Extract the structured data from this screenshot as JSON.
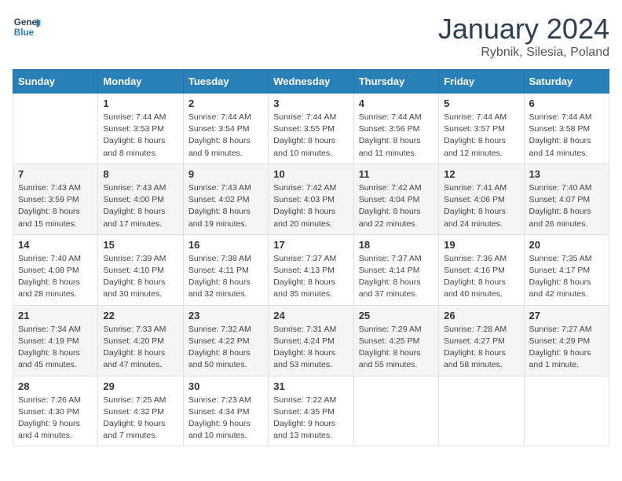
{
  "logo": {
    "line1": "General",
    "line2": "Blue"
  },
  "title": "January 2024",
  "location": "Rybnik, Silesia, Poland",
  "days": [
    "Sunday",
    "Monday",
    "Tuesday",
    "Wednesday",
    "Thursday",
    "Friday",
    "Saturday"
  ],
  "weeks": [
    [
      {
        "date": "",
        "content": ""
      },
      {
        "date": "1",
        "content": "Sunrise: 7:44 AM\nSunset: 3:53 PM\nDaylight: 8 hours\nand 8 minutes."
      },
      {
        "date": "2",
        "content": "Sunrise: 7:44 AM\nSunset: 3:54 PM\nDaylight: 8 hours\nand 9 minutes."
      },
      {
        "date": "3",
        "content": "Sunrise: 7:44 AM\nSunset: 3:55 PM\nDaylight: 8 hours\nand 10 minutes."
      },
      {
        "date": "4",
        "content": "Sunrise: 7:44 AM\nSunset: 3:56 PM\nDaylight: 8 hours\nand 11 minutes."
      },
      {
        "date": "5",
        "content": "Sunrise: 7:44 AM\nSunset: 3:57 PM\nDaylight: 8 hours\nand 12 minutes."
      },
      {
        "date": "6",
        "content": "Sunrise: 7:44 AM\nSunset: 3:58 PM\nDaylight: 8 hours\nand 14 minutes."
      }
    ],
    [
      {
        "date": "7",
        "content": "Sunrise: 7:43 AM\nSunset: 3:59 PM\nDaylight: 8 hours\nand 15 minutes."
      },
      {
        "date": "8",
        "content": "Sunrise: 7:43 AM\nSunset: 4:00 PM\nDaylight: 8 hours\nand 17 minutes."
      },
      {
        "date": "9",
        "content": "Sunrise: 7:43 AM\nSunset: 4:02 PM\nDaylight: 8 hours\nand 19 minutes."
      },
      {
        "date": "10",
        "content": "Sunrise: 7:42 AM\nSunset: 4:03 PM\nDaylight: 8 hours\nand 20 minutes."
      },
      {
        "date": "11",
        "content": "Sunrise: 7:42 AM\nSunset: 4:04 PM\nDaylight: 8 hours\nand 22 minutes."
      },
      {
        "date": "12",
        "content": "Sunrise: 7:41 AM\nSunset: 4:06 PM\nDaylight: 8 hours\nand 24 minutes."
      },
      {
        "date": "13",
        "content": "Sunrise: 7:40 AM\nSunset: 4:07 PM\nDaylight: 8 hours\nand 26 minutes."
      }
    ],
    [
      {
        "date": "14",
        "content": "Sunrise: 7:40 AM\nSunset: 4:08 PM\nDaylight: 8 hours\nand 28 minutes."
      },
      {
        "date": "15",
        "content": "Sunrise: 7:39 AM\nSunset: 4:10 PM\nDaylight: 8 hours\nand 30 minutes."
      },
      {
        "date": "16",
        "content": "Sunrise: 7:38 AM\nSunset: 4:11 PM\nDaylight: 8 hours\nand 32 minutes."
      },
      {
        "date": "17",
        "content": "Sunrise: 7:37 AM\nSunset: 4:13 PM\nDaylight: 8 hours\nand 35 minutes."
      },
      {
        "date": "18",
        "content": "Sunrise: 7:37 AM\nSunset: 4:14 PM\nDaylight: 8 hours\nand 37 minutes."
      },
      {
        "date": "19",
        "content": "Sunrise: 7:36 AM\nSunset: 4:16 PM\nDaylight: 8 hours\nand 40 minutes."
      },
      {
        "date": "20",
        "content": "Sunrise: 7:35 AM\nSunset: 4:17 PM\nDaylight: 8 hours\nand 42 minutes."
      }
    ],
    [
      {
        "date": "21",
        "content": "Sunrise: 7:34 AM\nSunset: 4:19 PM\nDaylight: 8 hours\nand 45 minutes."
      },
      {
        "date": "22",
        "content": "Sunrise: 7:33 AM\nSunset: 4:20 PM\nDaylight: 8 hours\nand 47 minutes."
      },
      {
        "date": "23",
        "content": "Sunrise: 7:32 AM\nSunset: 4:22 PM\nDaylight: 8 hours\nand 50 minutes."
      },
      {
        "date": "24",
        "content": "Sunrise: 7:31 AM\nSunset: 4:24 PM\nDaylight: 8 hours\nand 53 minutes."
      },
      {
        "date": "25",
        "content": "Sunrise: 7:29 AM\nSunset: 4:25 PM\nDaylight: 8 hours\nand 55 minutes."
      },
      {
        "date": "26",
        "content": "Sunrise: 7:28 AM\nSunset: 4:27 PM\nDaylight: 8 hours\nand 58 minutes."
      },
      {
        "date": "27",
        "content": "Sunrise: 7:27 AM\nSunset: 4:29 PM\nDaylight: 9 hours\nand 1 minute."
      }
    ],
    [
      {
        "date": "28",
        "content": "Sunrise: 7:26 AM\nSunset: 4:30 PM\nDaylight: 9 hours\nand 4 minutes."
      },
      {
        "date": "29",
        "content": "Sunrise: 7:25 AM\nSunset: 4:32 PM\nDaylight: 9 hours\nand 7 minutes."
      },
      {
        "date": "30",
        "content": "Sunrise: 7:23 AM\nSunset: 4:34 PM\nDaylight: 9 hours\nand 10 minutes."
      },
      {
        "date": "31",
        "content": "Sunrise: 7:22 AM\nSunset: 4:35 PM\nDaylight: 9 hours\nand 13 minutes."
      },
      {
        "date": "",
        "content": ""
      },
      {
        "date": "",
        "content": ""
      },
      {
        "date": "",
        "content": ""
      }
    ]
  ]
}
